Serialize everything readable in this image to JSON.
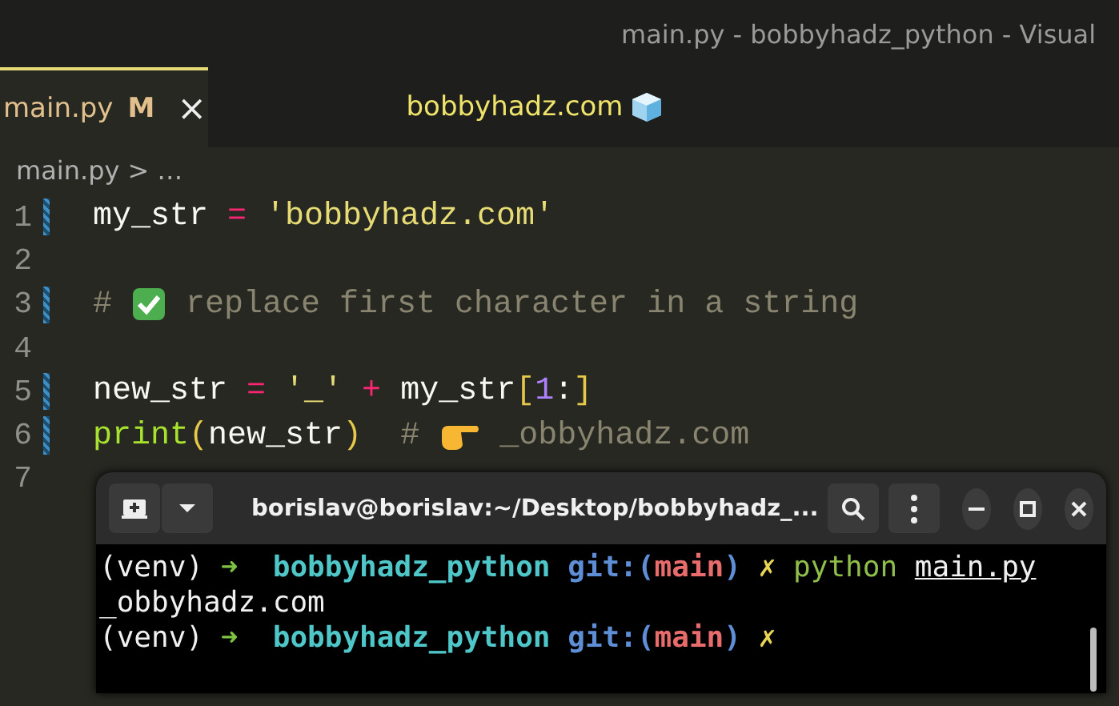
{
  "window": {
    "title": "main.py - bobbyhadz_python - Visual"
  },
  "tabs": [
    {
      "label": "main.py",
      "badge": "M",
      "close": "×",
      "selected": true
    }
  ],
  "banner": {
    "text": "bobbyhadz.com"
  },
  "breadcrumb": {
    "file": "main.py",
    "separator": ">",
    "rest": "…"
  },
  "editor": {
    "lines": [
      {
        "number": "1",
        "modified": true,
        "tokens": [
          {
            "kind": "plain",
            "text": "my_str "
          },
          {
            "kind": "op",
            "text": "="
          },
          {
            "kind": "string",
            "text": " 'bobbyhadz.com'"
          }
        ]
      },
      {
        "number": "2",
        "modified": false
      },
      {
        "number": "3",
        "modified": true,
        "tokens": [
          {
            "kind": "comment",
            "text": "# "
          },
          {
            "kind": "check-mark"
          },
          {
            "kind": "comment",
            "text": " replace first character in a string"
          }
        ]
      },
      {
        "number": "4",
        "modified": false
      },
      {
        "number": "5",
        "modified": true,
        "tokens": [
          {
            "kind": "plain",
            "text": "new_str "
          },
          {
            "kind": "op",
            "text": "="
          },
          {
            "kind": "string",
            "text": " '_' "
          },
          {
            "kind": "op",
            "text": "+"
          },
          {
            "kind": "plain",
            "text": " my_str"
          },
          {
            "kind": "bracket",
            "text": "["
          },
          {
            "kind": "number",
            "text": "1"
          },
          {
            "kind": "plain",
            "text": ":"
          },
          {
            "kind": "bracket",
            "text": "]"
          }
        ]
      },
      {
        "number": "6",
        "modified": true,
        "tokens": [
          {
            "kind": "func",
            "text": "print"
          },
          {
            "kind": "bracket",
            "text": "("
          },
          {
            "kind": "plain",
            "text": "new_str"
          },
          {
            "kind": "bracket",
            "text": ")"
          },
          {
            "kind": "comment",
            "text": "  # "
          },
          {
            "kind": "pointer"
          },
          {
            "kind": "comment",
            "text": " _obbyhadz.com"
          }
        ]
      },
      {
        "number": "7",
        "modified": false
      }
    ]
  },
  "terminal": {
    "title": "borislav@borislav:~/Desktop/bobbyhadz_...",
    "lines": [
      [
        {
          "kind": "plain",
          "text": "(venv) "
        },
        {
          "kind": "arrow",
          "text": "➜"
        },
        {
          "kind": "dir",
          "text": "  bobbyhadz_python "
        },
        {
          "kind": "git",
          "text": "git:("
        },
        {
          "kind": "branch",
          "text": "main"
        },
        {
          "kind": "git",
          "text": ")"
        },
        {
          "kind": "mark",
          "text": " ✗"
        },
        {
          "kind": "cmd",
          "text": " python "
        },
        {
          "kind": "arg",
          "text": "main.py"
        }
      ],
      [
        {
          "kind": "plain",
          "text": "_obbyhadz.com"
        }
      ],
      [
        {
          "kind": "plain",
          "text": "(venv) "
        },
        {
          "kind": "arrow",
          "text": "➜"
        },
        {
          "kind": "dir",
          "text": "  bobbyhadz_python "
        },
        {
          "kind": "git",
          "text": "git:("
        },
        {
          "kind": "branch",
          "text": "main"
        },
        {
          "kind": "git",
          "text": ")"
        },
        {
          "kind": "mark",
          "text": " ✗"
        }
      ]
    ]
  }
}
